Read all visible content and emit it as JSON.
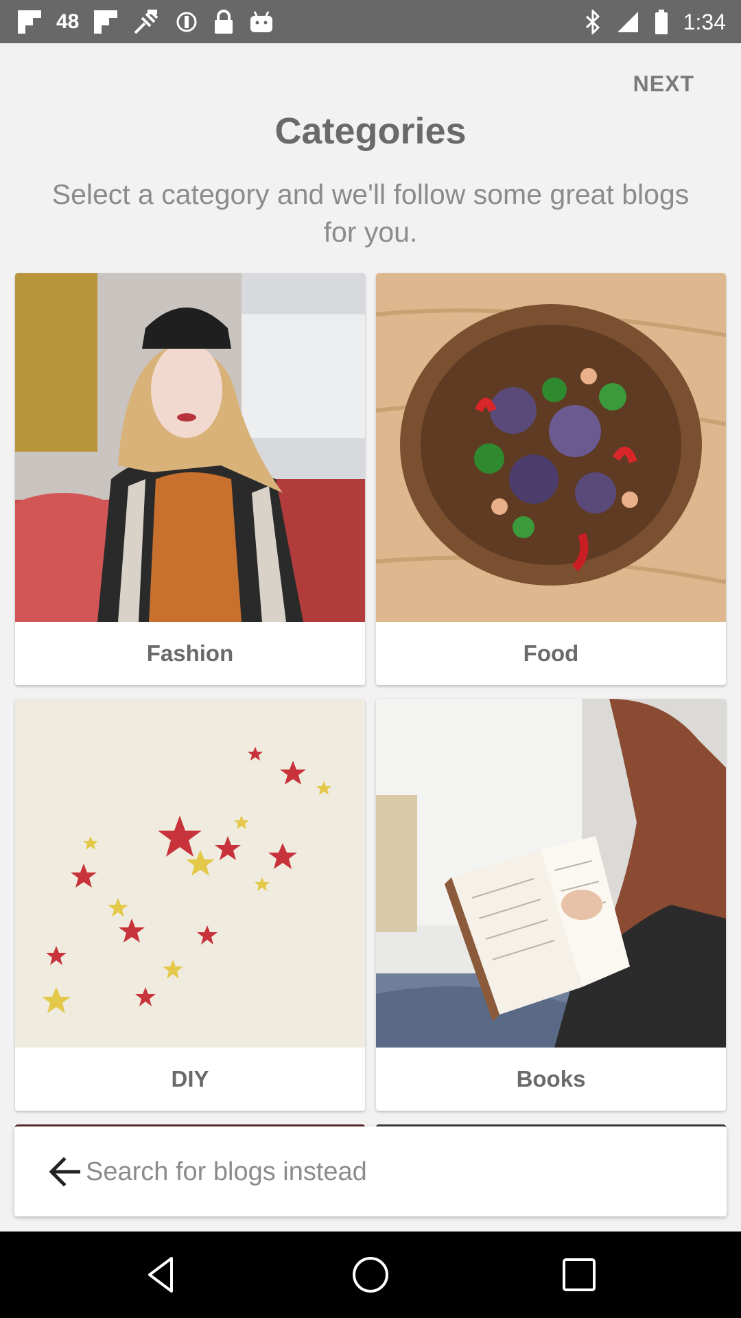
{
  "status_bar": {
    "notification_count": "48",
    "time": "1:34",
    "icons": [
      "flipboard-icon",
      "notification-count",
      "flipboard-icon",
      "fake-gps-icon",
      "sync-icon",
      "lock-icon",
      "android-icon",
      "bluetooth-icon",
      "cellular-icon",
      "battery-icon"
    ]
  },
  "header": {
    "next_label": "NEXT",
    "title": "Categories",
    "subtitle": "Select a category and we'll follow some great blogs for you."
  },
  "categories": [
    {
      "label": "Fashion"
    },
    {
      "label": "Food"
    },
    {
      "label": "DIY"
    },
    {
      "label": "Books"
    }
  ],
  "search": {
    "placeholder": "Search for blogs instead"
  },
  "navbar": {
    "icons": [
      "back-triangle-icon",
      "home-circle-icon",
      "recents-square-icon"
    ]
  },
  "colors": {
    "status_bar": "#686868",
    "background": "#f2f2f2",
    "text_gray": "#6a6a6a",
    "navbar": "#000000"
  }
}
